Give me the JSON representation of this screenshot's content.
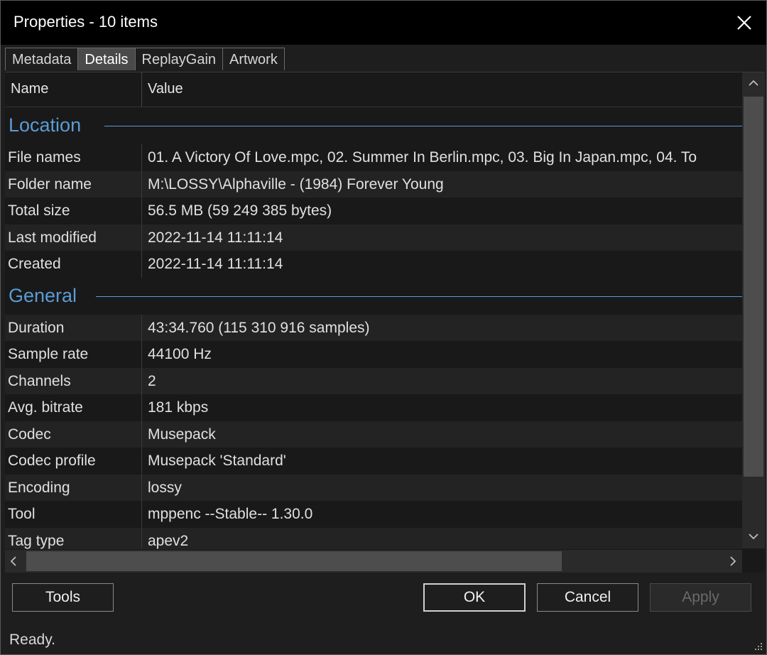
{
  "window": {
    "title": "Properties - 10 items"
  },
  "tabs": [
    {
      "label": "Metadata",
      "active": false
    },
    {
      "label": "Details",
      "active": true
    },
    {
      "label": "ReplayGain",
      "active": false
    },
    {
      "label": "Artwork",
      "active": false
    }
  ],
  "columns": {
    "name": "Name",
    "value": "Value"
  },
  "groups": {
    "location": {
      "label": "Location",
      "rows": [
        {
          "name": "File names",
          "value": "01. A Victory Of Love.mpc, 02. Summer In Berlin.mpc, 03. Big In Japan.mpc, 04. To"
        },
        {
          "name": "Folder name",
          "value": "M:\\LOSSY\\Alphaville - (1984) Forever Young"
        },
        {
          "name": "Total size",
          "value": "56.5 MB (59 249 385 bytes)"
        },
        {
          "name": "Last modified",
          "value": "2022-11-14 11:11:14"
        },
        {
          "name": "Created",
          "value": "2022-11-14 11:11:14"
        }
      ]
    },
    "general": {
      "label": "General",
      "rows": [
        {
          "name": "Duration",
          "value": "43:34.760 (115 310 916 samples)"
        },
        {
          "name": "Sample rate",
          "value": "44100 Hz"
        },
        {
          "name": "Channels",
          "value": "2"
        },
        {
          "name": "Avg. bitrate",
          "value": "181 kbps"
        },
        {
          "name": "Codec",
          "value": "Musepack"
        },
        {
          "name": "Codec profile",
          "value": "Musepack 'Standard'"
        },
        {
          "name": "Encoding",
          "value": "lossy"
        },
        {
          "name": "Tool",
          "value": "mppenc --Stable-- 1.30.0"
        },
        {
          "name": "Tag type",
          "value": "apev2"
        }
      ]
    }
  },
  "buttons": {
    "tools": "Tools",
    "ok": "OK",
    "cancel": "Cancel",
    "apply": "Apply"
  },
  "status": {
    "text": "Ready."
  },
  "colors": {
    "accent": "#5b9bd5",
    "background": "#1e1e1e",
    "titlebar": "#000000"
  },
  "icons": {
    "close": "close-icon",
    "resize": "resize-grip-icon"
  }
}
